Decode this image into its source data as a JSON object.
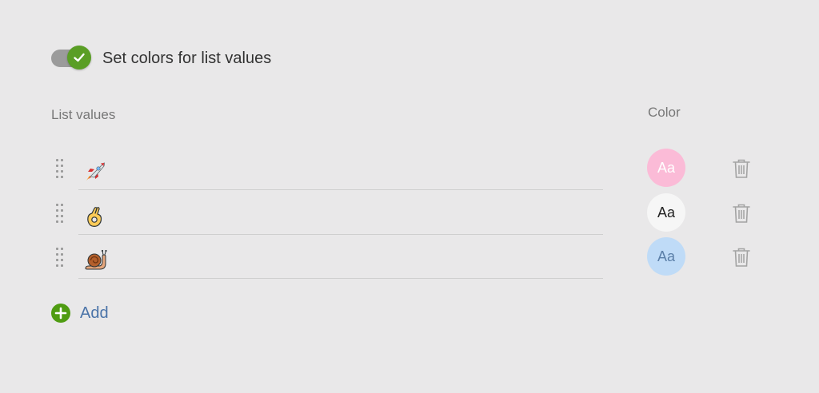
{
  "toggle": {
    "label": "Set colors for list values",
    "checked": true,
    "track_color": "#9b9b9b",
    "knob_color": "#5a9e25",
    "icon": "check-icon"
  },
  "headers": {
    "list_values": "List values",
    "color": "Color"
  },
  "rows": [
    {
      "emoji": "rocket",
      "swatch_label": "Aa",
      "swatch_bg": "#fbbbd7",
      "swatch_fg": "#ffffff"
    },
    {
      "emoji": "ok-hand",
      "swatch_label": "Aa",
      "swatch_bg": "#f6f6f6",
      "swatch_fg": "#222222"
    },
    {
      "emoji": "snail",
      "swatch_label": "Aa",
      "swatch_bg": "#bfdbf7",
      "swatch_fg": "#5b7fa8"
    }
  ],
  "add": {
    "label": "Add",
    "icon_color": "#4f9c12",
    "label_color": "#4a73a8"
  }
}
